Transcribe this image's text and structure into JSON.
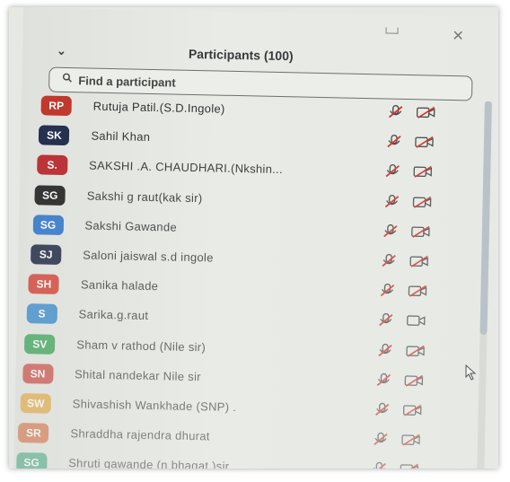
{
  "header": {
    "title": "Participants (100)"
  },
  "search": {
    "placeholder": "Find a participant"
  },
  "participants": [
    {
      "initials": "RP",
      "name": "Rutuja Patil.(S.D.Ingole)",
      "color": "#c0392b",
      "mic": "muted",
      "video": "off"
    },
    {
      "initials": "SK",
      "name": "Sahil Khan",
      "color": "#1f2a4a",
      "mic": "muted",
      "video": "off"
    },
    {
      "initials": "S.",
      "name": "SAKSHI .A. CHAUDHARI.(Nkshin...",
      "color": "#b8262b",
      "mic": "muted",
      "video": "off"
    },
    {
      "initials": "SG",
      "name": "Sakshi g raut(kak sir)",
      "color": "#1e1e1e",
      "mic": "muted",
      "video": "off"
    },
    {
      "initials": "SG",
      "name": "Sakshi Gawande",
      "color": "#2c73c9",
      "mic": "muted",
      "video": "off"
    },
    {
      "initials": "SJ",
      "name": "Saloni jaiswal s.d ingole",
      "color": "#1a2340",
      "mic": "muted",
      "video": "off"
    },
    {
      "initials": "SH",
      "name": "Sanika halade",
      "color": "#d23b2f",
      "mic": "muted",
      "video": "off"
    },
    {
      "initials": "S",
      "name": "Sarika.g.raut",
      "color": "#2f86c8",
      "mic": "muted",
      "video": "on"
    },
    {
      "initials": "SV",
      "name": "Sham v rathod (Nile sir)",
      "color": "#2f9e4e",
      "mic": "muted",
      "video": "off"
    },
    {
      "initials": "SN",
      "name": "Shital nandekar Nile sir",
      "color": "#c9413a",
      "mic": "muted",
      "video": "off"
    },
    {
      "initials": "SW",
      "name": "Shivashish Wankhade (SNP) .",
      "color": "#e0a33a",
      "mic": "muted",
      "video": "off"
    },
    {
      "initials": "SR",
      "name": "Shraddha rajendra dhurat",
      "color": "#d2693a",
      "mic": "muted",
      "video": "off"
    },
    {
      "initials": "SG",
      "name": "Shruti gawande (n bhagat )sir",
      "color": "#3aa37a",
      "mic": "muted",
      "video": "off"
    }
  ]
}
